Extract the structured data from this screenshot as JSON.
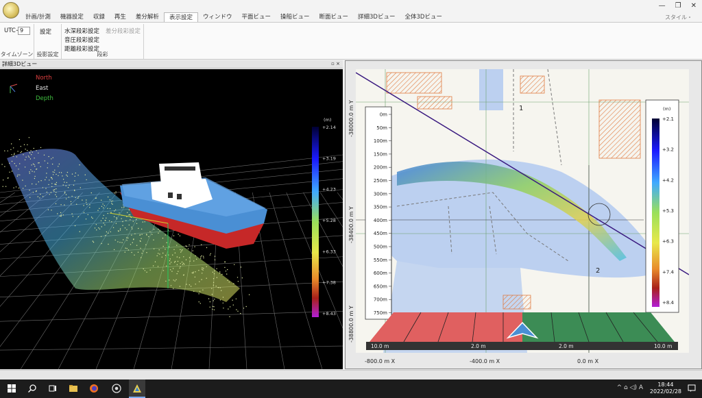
{
  "tabs": [
    {
      "label": "計画/計測",
      "active": false
    },
    {
      "label": "機器設定",
      "active": false
    },
    {
      "label": "収録",
      "active": false
    },
    {
      "label": "再生",
      "active": false
    },
    {
      "label": "差分解析",
      "active": false
    },
    {
      "label": "表示設定",
      "active": true
    },
    {
      "label": "ウィンドウ",
      "active": false
    },
    {
      "label": "平面ビュー",
      "active": false
    },
    {
      "label": "操船ビュー",
      "active": false
    },
    {
      "label": "断面ビュー",
      "active": false
    },
    {
      "label": "詳細3Dビュー",
      "active": false
    },
    {
      "label": "全体3Dビュー",
      "active": false
    }
  ],
  "window_controls": {
    "minimize": "—",
    "restore": "❐",
    "close": "✕"
  },
  "style_menu": "スタイル・",
  "ribbon": {
    "utc_label": "UTC+",
    "utc_value": "9",
    "timezone_group": "タイムゾーン",
    "settings_button": "設定",
    "projection_group": "投影設定",
    "color_buttons": [
      "水深段彩設定",
      "音圧段彩設定",
      "距離段彩設定"
    ],
    "diff_color_button": "差分段彩設定",
    "color_group": "段彩"
  },
  "detail_panel": {
    "title": "詳細3Dビュー",
    "header_controls": "▫ ×",
    "axis_labels": {
      "north": "North",
      "east": "East",
      "depth": "Depth"
    },
    "colorbar": {
      "unit": "(m)",
      "ticks": [
        "+2.14",
        "+3.19",
        "+4.23",
        "+5.28",
        "+6.33",
        "+7.38",
        "+8.43"
      ]
    }
  },
  "map_panel": {
    "y_labels": [
      "-38000.0 m Y",
      "-38400.0 m Y",
      "-38800.0 m Y"
    ],
    "x_labels": [
      "-800.0 m X",
      "-400.0 m X",
      "0.0 m X"
    ],
    "depth_scale": [
      "0m",
      "50m",
      "100m",
      "150m",
      "200m",
      "250m",
      "300m",
      "350m",
      "400m",
      "450m",
      "500m",
      "550m",
      "600m",
      "650m",
      "700m",
      "750m"
    ],
    "colorbar": {
      "unit": "(m)",
      "ticks": [
        "+2.1",
        "+3.2",
        "+4.2",
        "+5.3",
        "+6.3",
        "+7.4",
        "+8.4"
      ]
    },
    "distance_bar": [
      "10.0 m",
      "2.0 m",
      "2.0 m",
      "10.0 m"
    ],
    "map_markers": [
      "1",
      "2"
    ]
  },
  "taskbar": {
    "tray": "^ ⌂ ◁) A",
    "time": "18:44",
    "date": "2022/02/28"
  },
  "colors": {
    "colorbar_stops": [
      "#000033",
      "#1a1aff",
      "#3fa9ff",
      "#9ae05a",
      "#e8e84a",
      "#e88a2a",
      "#a8201a",
      "#b21fd6"
    ],
    "ship_hull": "#4a8fd4",
    "ship_keel": "#c62828",
    "port_red": "#e06060",
    "starboard_green": "#3c8c55"
  }
}
